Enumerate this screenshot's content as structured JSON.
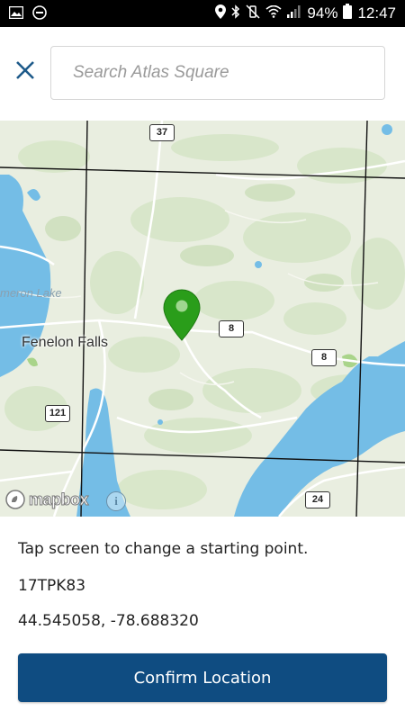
{
  "status_bar": {
    "battery": "94%",
    "time": "12:47"
  },
  "header": {
    "search_placeholder": "Search Atlas Square"
  },
  "map": {
    "labels": {
      "town": "Fenelon Falls",
      "lake": "meron Lake"
    },
    "route_shields": [
      "37",
      "8",
      "8",
      "121",
      "24"
    ],
    "attribution": "mapbox",
    "colors": {
      "land": "#e9eee0",
      "water": "#74bde6",
      "pin": "#2a9d1a"
    }
  },
  "panel": {
    "instruction": "Tap screen to change a starting point.",
    "atlas_square": "17TPK83",
    "coordinates": "44.545058, -78.688320",
    "confirm_label": "Confirm Location",
    "button_color": "#0f4c81"
  }
}
